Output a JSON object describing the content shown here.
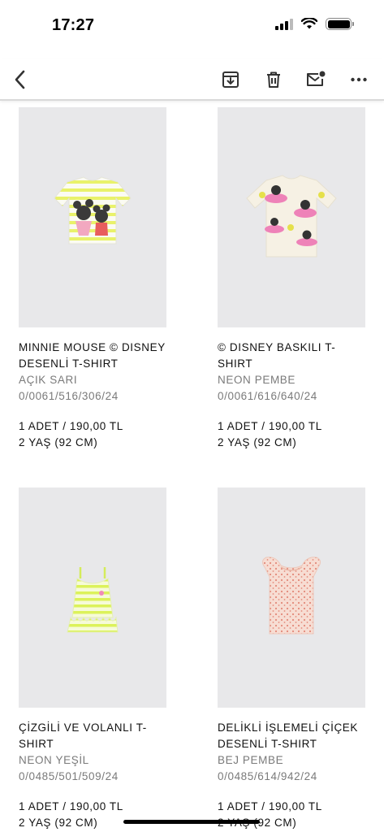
{
  "status": {
    "time": "17:27"
  },
  "toolbar": {
    "back_icon": "chevron-left-icon",
    "actions": [
      "archive-icon",
      "trash-icon",
      "mail-unread-icon",
      "more-icon"
    ]
  },
  "products": [
    {
      "name": "MINNIE MOUSE © DISNEY DESENLİ T-SHIRT",
      "color": "AÇIK SARI",
      "ref": "0/0061/516/306/24",
      "qty": "1 ADET / 190,00 TL",
      "size": "2 YAŞ (92 CM)"
    },
    {
      "name": "© DISNEY BASKILI T-SHIRT",
      "color": "NEON PEMBE",
      "ref": "0/0061/616/640/24",
      "qty": "1 ADET / 190,00 TL",
      "size": "2 YAŞ (92 CM)"
    },
    {
      "name": "ÇİZGİLİ VE VOLANLI T-SHIRT",
      "color": "NEON YEŞİL",
      "ref": "0/0485/501/509/24",
      "qty": "1 ADET / 190,00 TL",
      "size": "2 YAŞ (92 CM)"
    },
    {
      "name": "DELİKLİ İŞLEMELİ ÇİÇEK DESENLİ T-SHIRT",
      "color": "BEJ PEMBE",
      "ref": "0/0485/614/942/24",
      "qty": "1 ADET / 190,00 TL",
      "size": "2 YAŞ (92 CM)"
    }
  ]
}
